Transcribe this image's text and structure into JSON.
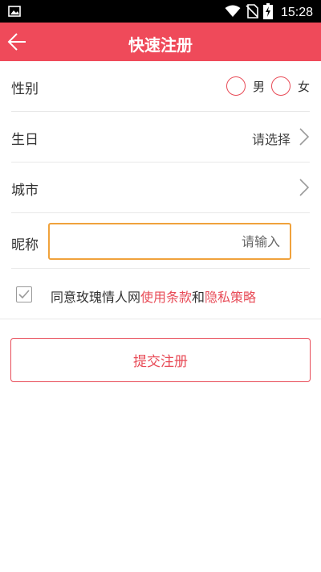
{
  "status_bar": {
    "time": "15:28",
    "icons": [
      "image-icon",
      "wifi-icon",
      "no-sim-icon",
      "battery-charging-icon"
    ]
  },
  "header": {
    "back_icon": "arrow-left-icon",
    "title": "快速注册"
  },
  "form": {
    "gender": {
      "label": "性别",
      "options": [
        {
          "label": "男",
          "selected": false
        },
        {
          "label": "女",
          "selected": false
        }
      ]
    },
    "birthday": {
      "label": "生日",
      "value": "请选择"
    },
    "city": {
      "label": "城市",
      "value": ""
    },
    "nickname": {
      "label": "昵称",
      "placeholder": "请输入",
      "value": ""
    },
    "agreement": {
      "checked": true,
      "prefix": "同意玫瑰情人网",
      "terms_link": "使用条款",
      "connector": "和",
      "privacy_link": "隐私策略"
    }
  },
  "submit_label": "提交注册",
  "colors": {
    "brand": "#ef4a5a",
    "accent": "#e84b57",
    "focus_border": "#f0a23c"
  }
}
